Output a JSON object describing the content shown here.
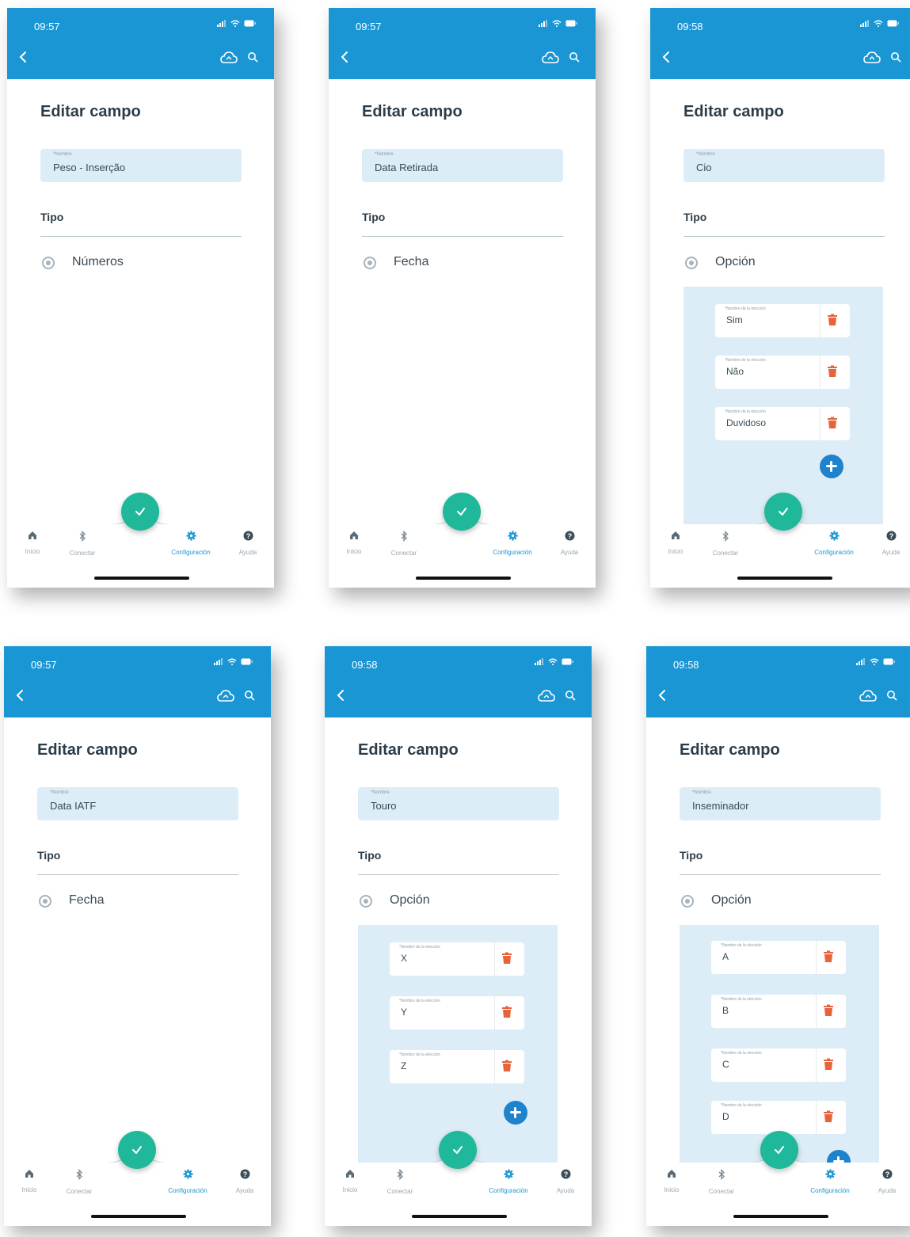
{
  "common": {
    "title": "Editar campo",
    "name_label": "*Nombre",
    "tipo_label": "Tipo",
    "choice_label": "*Nombre de la elección",
    "nav": [
      {
        "label": "Inicio",
        "icon": "home-icon"
      },
      {
        "label": "Conectar",
        "icon": "bluetooth-icon"
      },
      {
        "label": "Configuración",
        "icon": "gear-icon",
        "active": true
      },
      {
        "label": "Ayuda",
        "icon": "help-icon"
      }
    ],
    "colors": {
      "appbar": "#1a96d4",
      "fab": "#1fb89a",
      "panel": "#dcedf7",
      "trash": "#e8623a",
      "add": "#1e82cc"
    }
  },
  "screens": [
    {
      "time": "09:57",
      "name": "Peso - Inserção",
      "type": "Números",
      "choices": []
    },
    {
      "time": "09:57",
      "name": "Data Retirada",
      "type": "Fecha",
      "choices": []
    },
    {
      "time": "09:58",
      "name": "Cio",
      "type": "Opción",
      "choices": [
        "Sim",
        "Não",
        "Duvidoso"
      ]
    },
    {
      "time": "09:57",
      "name": "Data IATF",
      "type": "Fecha",
      "choices": []
    },
    {
      "time": "09:58",
      "name": "Touro",
      "type": "Opción",
      "choices": [
        "X",
        "Y",
        "Z"
      ]
    },
    {
      "time": "09:58",
      "name": "Inseminador",
      "type": "Opción",
      "choices": [
        "A",
        "B",
        "C",
        "D"
      ]
    }
  ]
}
